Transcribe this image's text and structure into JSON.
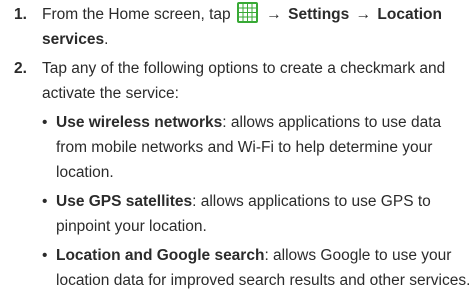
{
  "steps": [
    {
      "number": "1.",
      "prefix": "From the Home screen, tap",
      "arrow1": "→",
      "item1": "Settings",
      "arrow2": "→",
      "item2": "Location services",
      "suffix": ".",
      "icon": "apps-grid-icon",
      "icon_color": "#38a935"
    },
    {
      "number": "2.",
      "text": "Tap any of the following options to create a checkmark and activate the service:"
    }
  ],
  "bullet_glyph": "•",
  "bullets": [
    {
      "term": "Use wireless networks",
      "desc": ": allows applications to use data from mobile networks and Wi-Fi to help determine your location."
    },
    {
      "term": "Use GPS satellites",
      "desc": ": allows applications to use GPS to pinpoint your location."
    },
    {
      "term": "Location and Google search",
      "desc": ": allows Google to use your location data for improved search results and other services."
    }
  ]
}
